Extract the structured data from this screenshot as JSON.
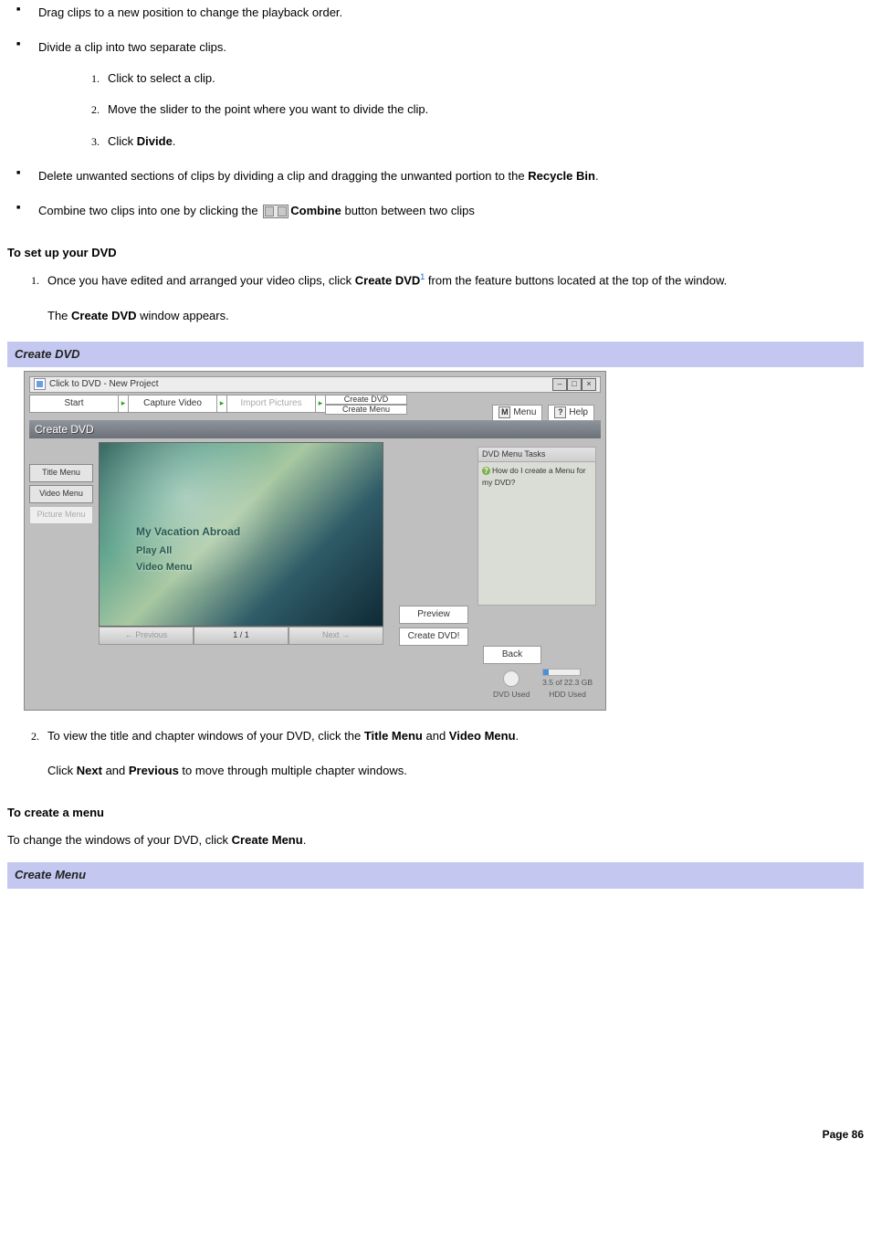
{
  "bullets": {
    "drag": "Drag clips to a new position to change the playback order.",
    "divide_intro": "Divide a clip into two separate clips.",
    "divide_steps": {
      "s1": "Click to select a clip.",
      "s2": "Move the slider to the point where you want to divide the clip.",
      "s3_pre": "Click ",
      "s3_b": "Divide",
      "s3_post": "."
    },
    "delete_pre": "Delete unwanted sections of clips by dividing a clip and dragging the unwanted portion to the ",
    "delete_b": "Recycle Bin",
    "delete_post": ".",
    "combine_pre": "Combine two clips into one by clicking the ",
    "combine_b": "Combine",
    "combine_post": " button between two clips"
  },
  "setup_heading": "To set up your DVD",
  "setup_step1_pre": "Once you have edited and arranged your video clips, click ",
  "setup_step1_b": "Create DVD",
  "setup_step1_sup": "1",
  "setup_step1_post": " from the feature buttons located at the top of the window.",
  "setup_step1_note_pre": "The ",
  "setup_step1_note_b": "Create DVD",
  "setup_step1_note_post": " window appears.",
  "caption1": "Create DVD",
  "setup_step2_pre": "To view the title and chapter windows of your DVD, click the ",
  "setup_step2_b1": "Title Menu",
  "setup_step2_mid": " and ",
  "setup_step2_b2": "Video Menu",
  "setup_step2_post": ".",
  "setup_step2_line2_pre": "Click ",
  "setup_step2_line2_b1": "Next",
  "setup_step2_line2_mid": " and ",
  "setup_step2_line2_b2": "Previous",
  "setup_step2_line2_post": " to move through multiple chapter windows.",
  "menu_heading": "To create a menu",
  "menu_intro_pre": "To change the windows of your DVD, click ",
  "menu_intro_b": "Create Menu",
  "menu_intro_post": ".",
  "caption2": "Create Menu",
  "page": "Page 86",
  "shot": {
    "title": "Click to DVD - New Project",
    "arrow": "▸",
    "crumb_start": "Start",
    "crumb_capture": "Capture Video",
    "crumb_import": "Import Pictures",
    "crumb_create_top": "Create DVD",
    "crumb_create_bot": "Create Menu",
    "menu_btn": "Menu",
    "menu_letter": "M",
    "help_btn": "Help",
    "help_letter": "?",
    "stripe": "Create DVD",
    "left_title": "Title Menu",
    "left_video": "Video Menu",
    "left_pic": "Picture Menu",
    "ov1": "My Vacation Abroad",
    "ov2": "Play All",
    "ov3": "Video Menu",
    "prev": "←  Previous",
    "page_ind": "1 / 1",
    "next": "Next  →",
    "side_preview": "Preview",
    "side_create": "Create DVD!",
    "tp_head": "DVD Menu Tasks",
    "tp_q": "How do I create a Menu for my DVD?",
    "back": "Back",
    "dvd_used": "DVD Used",
    "hdd_num": "3.5 of 22.3 GB",
    "hdd_used": "HDD Used",
    "win_min": "–",
    "win_max": "□",
    "win_close": "×"
  }
}
